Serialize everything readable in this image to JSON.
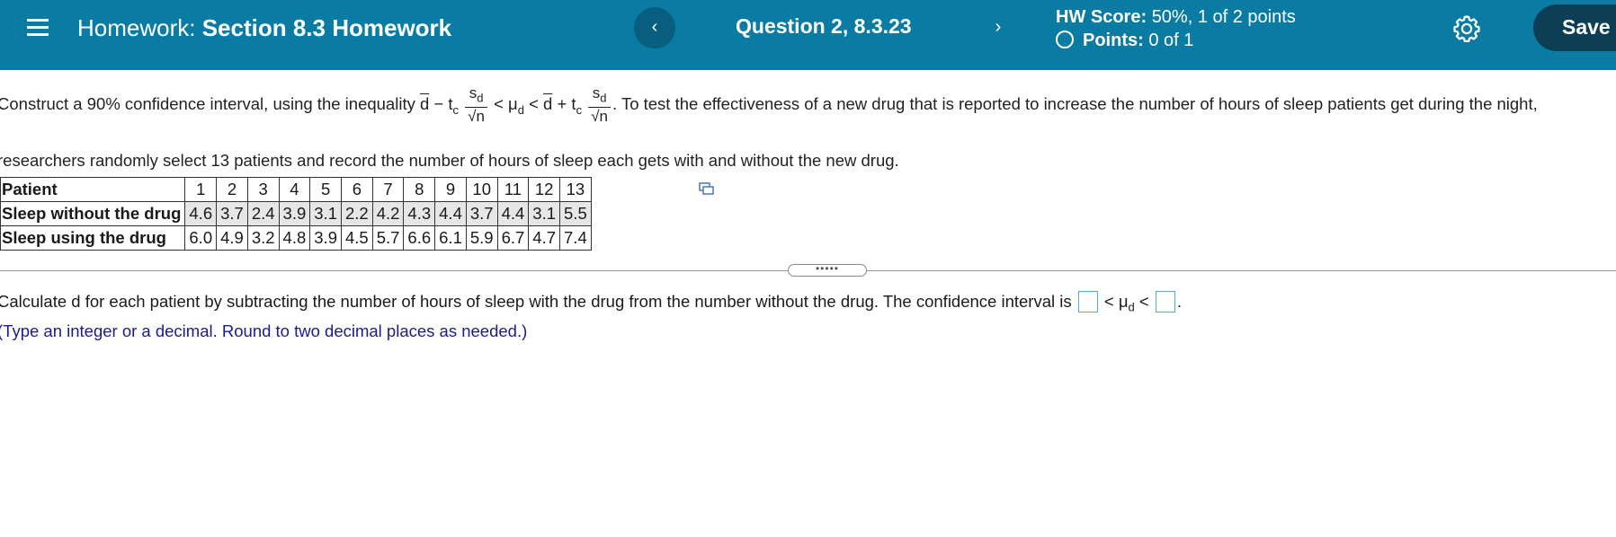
{
  "header": {
    "title_prefix": "Homework:",
    "title_section": "Section 8.3 Homework",
    "prev_glyph": "‹",
    "next_glyph": "›",
    "question": "Question 2, 8.3.23",
    "score_label": "HW Score:",
    "score_value": "50%, 1 of 2 points",
    "points_label": "Points:",
    "points_value": "0 of 1",
    "save_label": "Save",
    "menu_icon": "hamburger-icon",
    "settings_icon": "gear-icon"
  },
  "problem": {
    "intro": "Construct a 90% confidence interval, using the inequality",
    "d_bar": "d",
    "minus": " − t",
    "c_sub": "c",
    "sd": "s",
    "sd_sub": "d",
    "sqrt_n": "√n",
    "lt_mu": " < μ",
    "mu_sub": "d",
    "lt2": " < ",
    "plus_t": " + t",
    "after": ". To test the effectiveness of a new drug that is reported to increase the number of hours of sleep patients get during the night,",
    "line2": "researchers randomly select 13 patients and record the number of hours of sleep each gets with and without the new drug."
  },
  "table": {
    "headers": [
      "Patient",
      "1",
      "2",
      "3",
      "4",
      "5",
      "6",
      "7",
      "8",
      "9",
      "10",
      "11",
      "12",
      "13"
    ],
    "row1": [
      "Sleep without the drug",
      "4.6",
      "3.7",
      "2.4",
      "3.9",
      "3.1",
      "2.2",
      "4.2",
      "4.3",
      "4.4",
      "3.7",
      "4.4",
      "3.1",
      "5.5"
    ],
    "row2": [
      "Sleep using the drug",
      "6.0",
      "4.9",
      "3.2",
      "4.8",
      "3.9",
      "4.5",
      "5.7",
      "6.6",
      "6.1",
      "5.9",
      "6.7",
      "4.7",
      "7.4"
    ]
  },
  "splitter_label": "•••••",
  "answer": {
    "text": "Calculate d for each patient by subtracting the number of hours of sleep with the drug from the number without the drug. The confidence interval is",
    "mid": " < μ",
    "mid_sub": "d",
    "mid_lt": " < ",
    "end": "."
  },
  "hint": "(Type an integer or a decimal. Round to two decimal places as needed.)"
}
